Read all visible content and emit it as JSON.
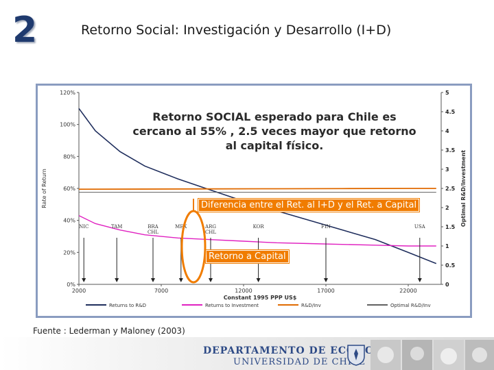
{
  "slide": {
    "number": "2",
    "title": "Retorno Social: Investigación y Desarrollo (I+D)",
    "callout": "Retorno SOCIAL esperado para Chile es cercano al 55% , 2.5 veces mayor que retorno al capital físico.",
    "box_difference": "Diferencia entre el Ret. al I+D y el Ret. a Capital",
    "box_capital": "Retorno a Capital",
    "source": "Fuente : Lederman y Maloney (2003)"
  },
  "footer": {
    "dept": "DEPARTAMENTO DE ECONOMIA",
    "univ": "UNIVERSIDAD DE CHILE"
  },
  "colors": {
    "title_number": "#1f3a6e",
    "frame": "#8a9cc0",
    "rd_return": "#1e2d5c",
    "investment_return": "#e020c0",
    "rd_inv_ratio": "#e06a00",
    "optimal_ratio": "#606060",
    "highlight": "#f07c00"
  },
  "chart_data": {
    "type": "line",
    "xlabel": "Constant 1995 PPP US$",
    "ylabel_left": "Rate of Return",
    "ylabel_right": "Optimal R&D/Investment",
    "x_ticks": [
      "2000",
      "7000",
      "12000",
      "17000",
      "22000"
    ],
    "x_range": [
      2000,
      24000
    ],
    "y_left_ticks": [
      "0%",
      "20%",
      "40%",
      "60%",
      "80%",
      "100%",
      "120%"
    ],
    "y_left_range": [
      0,
      120
    ],
    "y_right_ticks": [
      "0",
      "0.5",
      "1",
      "1.5",
      "2",
      "2.5",
      "3",
      "3.5",
      "4",
      "4.5",
      "5"
    ],
    "y_right_range": [
      0,
      5
    ],
    "series": [
      {
        "name": "Returns to R&D",
        "x": [
          2000,
          3000,
          4500,
          6000,
          8000,
          10000,
          12000,
          14000,
          16000,
          18000,
          20000,
          22000,
          23700
        ],
        "y": [
          110,
          96,
          83,
          74,
          66,
          59,
          52,
          46,
          40,
          34,
          28,
          20,
          13
        ]
      },
      {
        "name": "Returns to Investment",
        "x": [
          2000,
          3000,
          4500,
          6000,
          8000,
          10000,
          12000,
          14000,
          16000,
          18000,
          20000,
          22000,
          23700
        ],
        "y": [
          43,
          38,
          34,
          31,
          29,
          28,
          27,
          26,
          25.5,
          25,
          24.5,
          24,
          24
        ]
      },
      {
        "name": "R&D/Inv",
        "x": [
          2000,
          6000,
          10000,
          14000,
          18000,
          22000,
          23700
        ],
        "y": [
          59.5,
          59.6,
          59.7,
          59.8,
          59.9,
          60.0,
          60.0
        ]
      },
      {
        "name": "Optimal R&D/Inv",
        "x": [
          2000,
          6000,
          10000,
          14000,
          18000,
          22000,
          23700
        ],
        "y": [
          57.6,
          57.6,
          57.6,
          57.6,
          57.6,
          57.6,
          57.6
        ]
      }
    ],
    "countries": [
      {
        "label": "NIC",
        "x": 2300
      },
      {
        "label": "TAM",
        "x": 4300
      },
      {
        "label": "BRA CHL",
        "x": 6500
      },
      {
        "label": "MEX",
        "x": 8200
      },
      {
        "label": "ARG CHL",
        "x": 10000
      },
      {
        "label": "KOR",
        "x": 12900
      },
      {
        "label": "FIN",
        "x": 17000
      },
      {
        "label": "USA",
        "x": 22700
      }
    ]
  }
}
